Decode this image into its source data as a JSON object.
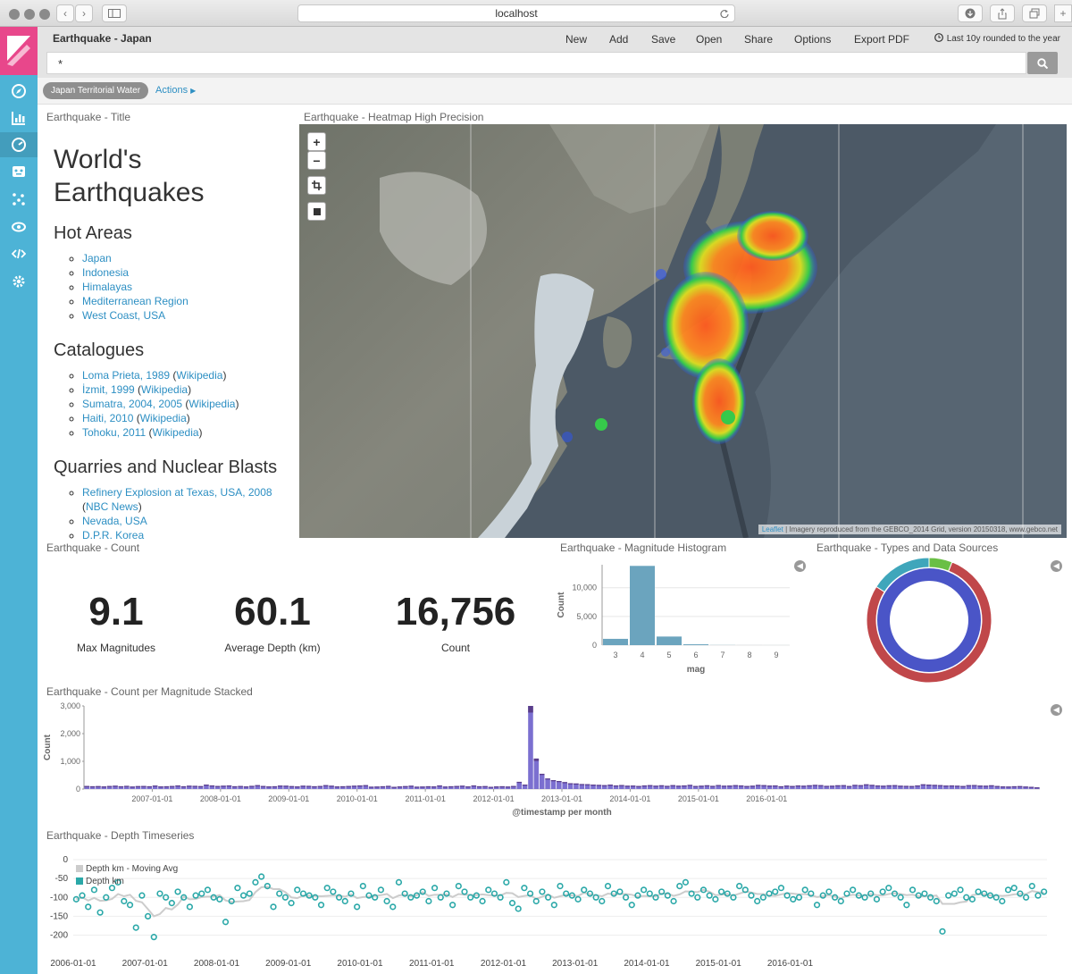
{
  "browser": {
    "url": "localhost"
  },
  "app": {
    "title": "Earthquake - Japan",
    "menu": [
      "New",
      "Add",
      "Save",
      "Open",
      "Share",
      "Options",
      "Export PDF"
    ],
    "time_range": "Last 10y rounded to the year"
  },
  "query": {
    "value": "*"
  },
  "filters": {
    "pill": "Japan Territorial Water",
    "actions": "Actions"
  },
  "panels": {
    "title_panel": "Earthquake - Title",
    "heatmap": "Earthquake - Heatmap High Precision",
    "count": "Earthquake - Count",
    "histogram": "Earthquake - Magnitude Histogram",
    "types": "Earthquake - Types and Data Sources",
    "stacked": "Earthquake - Count per Magnitude Stacked",
    "depth": "Earthquake - Depth Timeseries"
  },
  "markdown": {
    "heading_line1": "World's",
    "heading_line2": "Earthquakes",
    "hot_areas_title": "Hot Areas",
    "hot_areas": [
      "Japan",
      "Indonesia",
      "Himalayas",
      "Mediterranean Region",
      "West Coast, USA"
    ],
    "catalogues_title": "Catalogues",
    "catalogues": [
      {
        "name": "Loma Prieta, 1989",
        "wiki": "Wikipedia"
      },
      {
        "name": "İzmit, 1999",
        "wiki": "Wikipedia"
      },
      {
        "name": "Sumatra, 2004, 2005",
        "wiki": "Wikipedia"
      },
      {
        "name": "Haiti, 2010",
        "wiki": "Wikipedia"
      },
      {
        "name": "Tohoku, 2011",
        "wiki": "Wikipedia"
      }
    ],
    "quarries_title": "Quarries and Nuclear Blasts",
    "quarries": {
      "item1_line1": "Refinery Explosion at Texas, USA, 2008",
      "item1_open": "(",
      "item1_link": "NBC News",
      "item1_close": ")",
      "item2": "Nevada, USA",
      "item3": "D.P.R. Korea"
    }
  },
  "map": {
    "attribution_link": "Leaflet",
    "attribution_text": "| Imagery reproduced from the GEBCO_2014 Grid, version 20150318, www.gebco.net",
    "zoom_in": "+",
    "zoom_out": "−"
  },
  "metrics": [
    {
      "value": "9.1",
      "label": "Max Magnitudes"
    },
    {
      "value": "60.1",
      "label": "Average Depth (km)"
    },
    {
      "value": "16,756",
      "label": "Count"
    }
  ],
  "colors": {
    "sidebar": "#4db3d6",
    "logo": "#e8478b",
    "histogram_bar": "#6ba4be",
    "stacked_main": "#7b6fd0",
    "stacked_top": "#5a3d8a",
    "depth_point": "#2aa8a8",
    "moving_avg": "#cccccc",
    "donut_inner": "#4a55c7",
    "donut_outer_main": "#c0474a",
    "donut_outer_teal": "#3fa6bb",
    "donut_outer_green": "#6abf45"
  },
  "chart_data": [
    {
      "type": "bar",
      "title": "Earthquake - Magnitude Histogram",
      "xlabel": "mag",
      "ylabel": "Count",
      "categories": [
        "3",
        "4",
        "5",
        "6",
        "7",
        "8",
        "9"
      ],
      "values": [
        1100,
        13800,
        1500,
        150,
        20,
        5,
        2
      ],
      "yticks": [
        "0",
        "5,000",
        "10,000"
      ],
      "ylim": [
        0,
        14000
      ],
      "grid": true
    },
    {
      "type": "pie",
      "title": "Earthquake - Types and Data Sources",
      "rings": [
        {
          "ring": "inner",
          "values": [
            100
          ]
        },
        {
          "ring": "outer",
          "values": [
            78,
            16,
            6
          ]
        }
      ]
    },
    {
      "type": "bar",
      "title": "Earthquake - Count per Magnitude Stacked",
      "xlabel": "@timestamp per month",
      "ylabel": "Count",
      "ylim": [
        0,
        3000
      ],
      "yticks": [
        "0",
        "1,000",
        "2,000",
        "3,000"
      ],
      "xticks": [
        "2007-01-01",
        "2008-01-01",
        "2009-01-01",
        "2010-01-01",
        "2011-01-01",
        "2012-01-01",
        "2013-01-01",
        "2014-01-01",
        "2015-01-01",
        "2016-01-01"
      ],
      "x_start": "2006-01",
      "values": [
        110,
        100,
        105,
        95,
        110,
        120,
        100,
        115,
        90,
        105,
        110,
        100,
        125,
        95,
        100,
        110,
        130,
        100,
        120,
        115,
        105,
        160,
        130,
        110,
        120,
        130,
        100,
        110,
        95,
        115,
        140,
        110,
        95,
        100,
        125,
        120,
        105,
        95,
        120,
        115,
        100,
        110,
        140,
        120,
        95,
        100,
        110,
        120,
        130,
        140,
        85,
        90,
        100,
        115,
        80,
        95,
        105,
        120,
        85,
        90,
        100,
        95,
        130,
        90,
        100,
        110,
        120,
        95,
        130,
        100,
        105,
        80,
        95,
        100,
        90,
        110,
        260,
        160,
        3000,
        1100,
        550,
        380,
        320,
        290,
        250,
        210,
        200,
        180,
        175,
        160,
        150,
        140,
        160,
        130,
        145,
        120,
        125,
        110,
        130,
        140,
        120,
        135,
        115,
        140,
        120,
        130,
        150,
        110,
        120,
        135,
        115,
        145,
        120,
        125,
        140,
        130,
        110,
        120,
        150,
        140,
        125,
        130,
        100,
        125,
        110,
        130,
        120,
        135,
        150,
        140,
        115,
        120,
        135,
        140,
        110,
        150,
        140,
        170,
        150,
        130,
        120,
        135,
        140,
        120,
        115,
        110,
        130,
        170,
        160,
        150,
        140,
        125,
        130,
        120,
        110,
        140,
        145,
        125,
        120,
        135,
        110,
        95,
        90,
        100,
        105,
        90,
        80,
        60
      ],
      "grid": false
    },
    {
      "type": "scatter",
      "title": "Earthquake - Depth Timeseries",
      "series": [
        {
          "name": "Depth km - Moving Avg"
        },
        {
          "name": "Depth km"
        }
      ],
      "ylim": [
        -220,
        0
      ],
      "yticks": [
        "0",
        "-50",
        "-100",
        "-150",
        "-200"
      ],
      "xticks": [
        "2006-01-01",
        "2007-01-01",
        "2008-01-01",
        "2009-01-01",
        "2010-01-01",
        "2011-01-01",
        "2012-01-01",
        "2013-01-01",
        "2014-01-01",
        "2015-01-01",
        "2016-01-01"
      ],
      "x_start": "2006-01",
      "values": [
        -105,
        -95,
        -125,
        -80,
        -140,
        -100,
        -75,
        -60,
        -110,
        -120,
        -180,
        -95,
        -150,
        -205,
        -90,
        -100,
        -115,
        -85,
        -100,
        -125,
        -95,
        -90,
        -80,
        -100,
        -105,
        -165,
        -110,
        -75,
        -95,
        -90,
        -60,
        -45,
        -70,
        -125,
        -90,
        -100,
        -115,
        -80,
        -90,
        -95,
        -100,
        -120,
        -75,
        -85,
        -100,
        -110,
        -90,
        -125,
        -70,
        -95,
        -100,
        -80,
        -110,
        -125,
        -60,
        -90,
        -100,
        -95,
        -85,
        -110,
        -75,
        -100,
        -90,
        -120,
        -70,
        -85,
        -100,
        -95,
        -110,
        -80,
        -90,
        -100,
        -60,
        -115,
        -130,
        -75,
        -90,
        -110,
        -85,
        -100,
        -120,
        -70,
        -90,
        -95,
        -105,
        -80,
        -90,
        -100,
        -110,
        -70,
        -90,
        -85,
        -100,
        -120,
        -95,
        -80,
        -90,
        -100,
        -85,
        -95,
        -110,
        -70,
        -60,
        -90,
        -100,
        -80,
        -95,
        -105,
        -85,
        -90,
        -100,
        -70,
        -80,
        -95,
        -110,
        -100,
        -90,
        -85,
        -75,
        -95,
        -105,
        -100,
        -80,
        -90,
        -120,
        -95,
        -85,
        -100,
        -110,
        -90,
        -80,
        -95,
        -100,
        -90,
        -105,
        -85,
        -75,
        -90,
        -100,
        -120,
        -80,
        -95,
        -90,
        -100,
        -110,
        -190,
        -95,
        -90,
        -80,
        -100,
        -105,
        -85,
        -90,
        -95,
        -100,
        -110,
        -80,
        -75,
        -90,
        -100,
        -70,
        -95,
        -85
      ]
    }
  ]
}
